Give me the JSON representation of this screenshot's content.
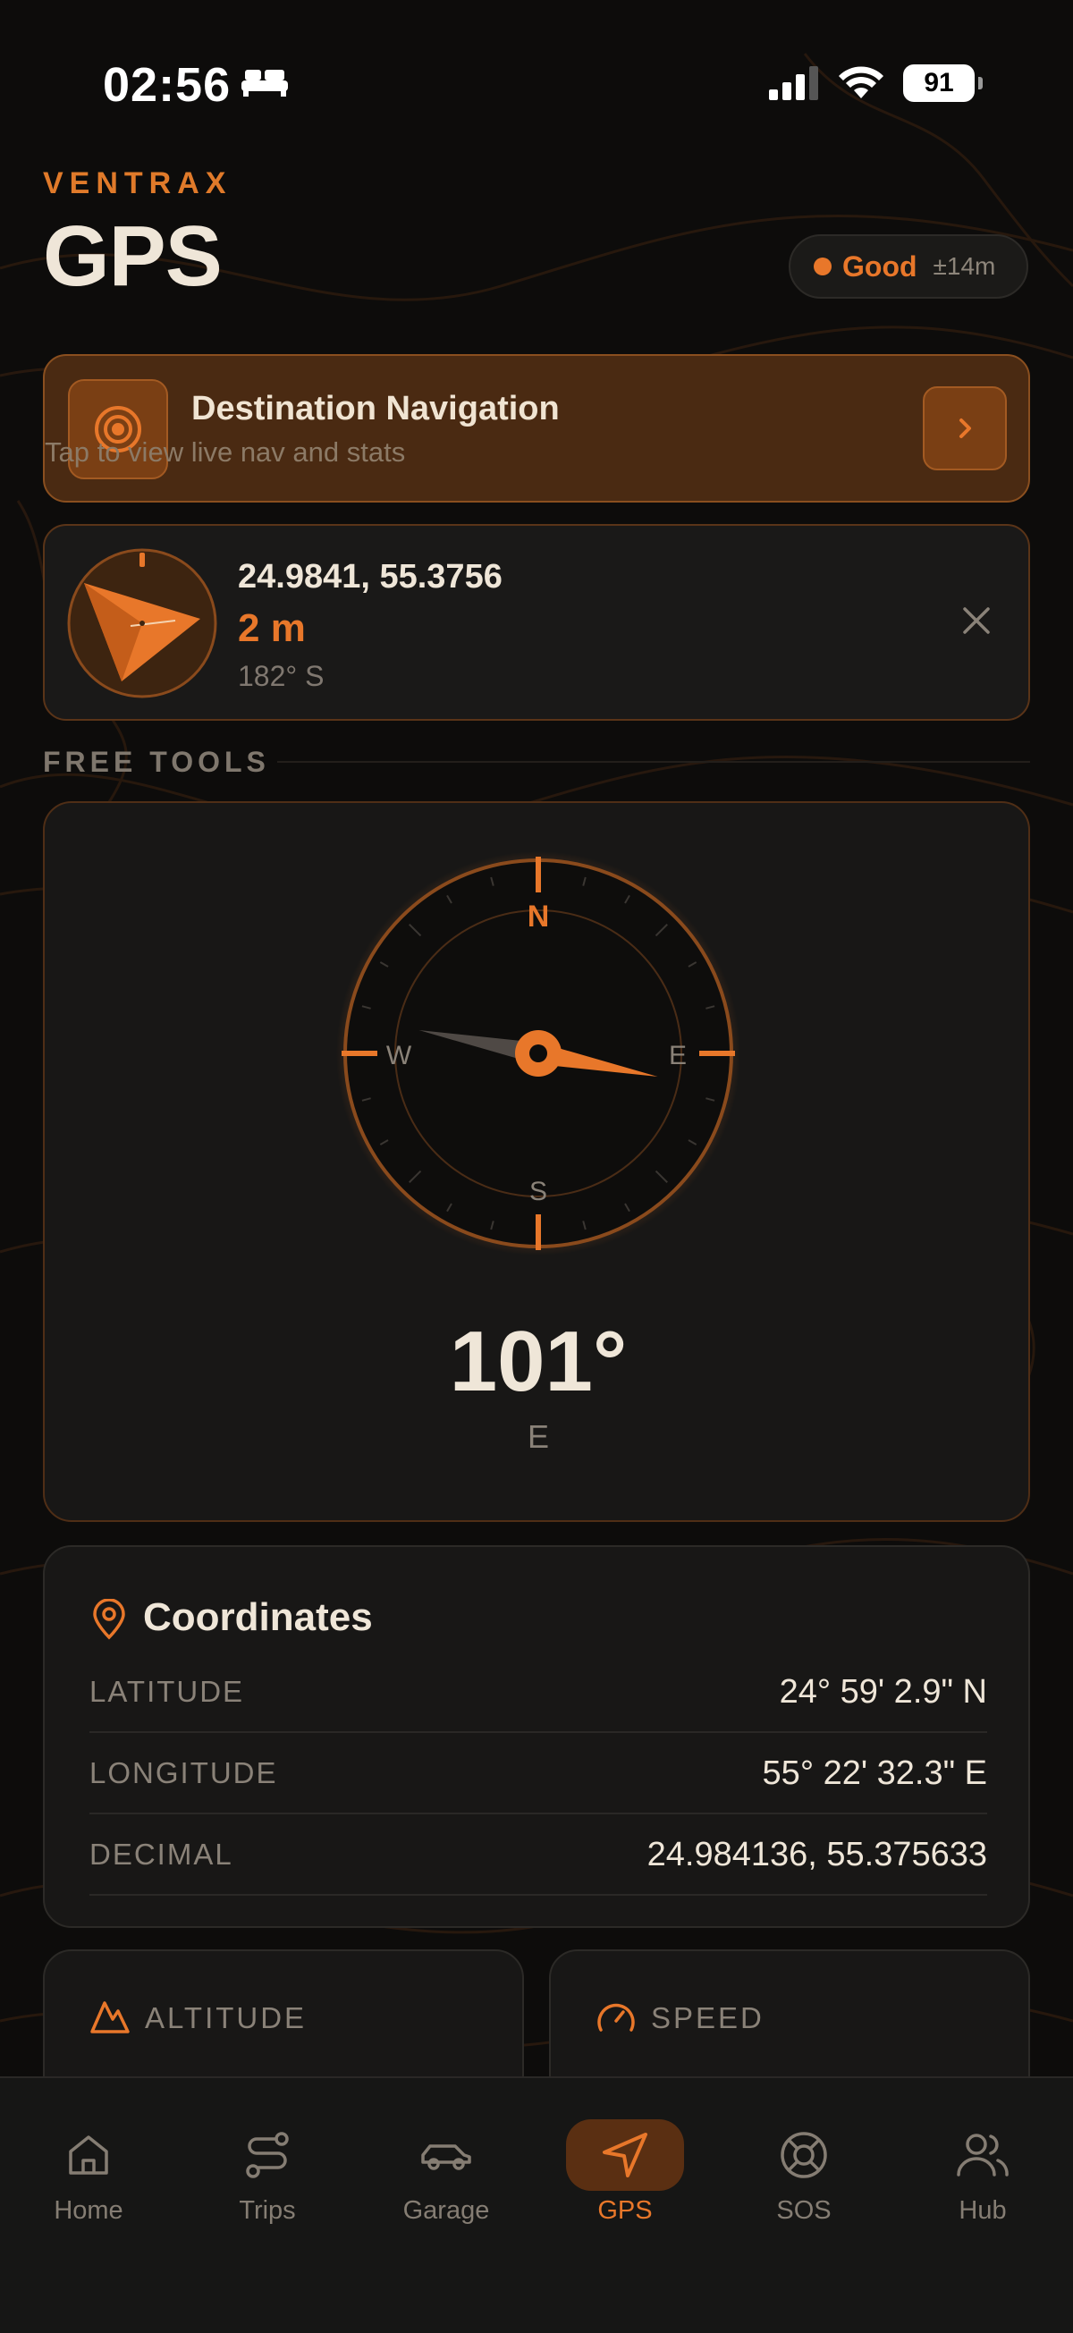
{
  "status_bar": {
    "time": "02:56",
    "battery": "91"
  },
  "header": {
    "brand": "VENTRAX",
    "title": "GPS"
  },
  "gps_signal": {
    "quality": "Good",
    "accuracy": "±14m"
  },
  "destination": {
    "title": "Destination Navigation",
    "subtitle": "Tap to view live nav and stats"
  },
  "waypoint": {
    "coords": "24.9841, 55.3756",
    "distance": "2 m",
    "bearing": "182°  S"
  },
  "section": {
    "free_tools": "FREE TOOLS"
  },
  "compass": {
    "cardinal": {
      "n": "N",
      "e": "E",
      "s": "S",
      "w": "W"
    },
    "heading": "101°",
    "heading_dir": "E",
    "heading_degrees": 101
  },
  "coordinates": {
    "title": "Coordinates",
    "rows": [
      {
        "key": "LATITUDE",
        "value": "24° 59' 2.9\" N"
      },
      {
        "key": "LONGITUDE",
        "value": "55° 22' 32.3\" E"
      },
      {
        "key": "DECIMAL",
        "value": "24.984136, 55.375633"
      }
    ]
  },
  "stats": {
    "altitude": "ALTITUDE",
    "speed": "SPEED"
  },
  "tabs": [
    {
      "label": "Home",
      "icon": "home-icon"
    },
    {
      "label": "Trips",
      "icon": "route-icon"
    },
    {
      "label": "Garage",
      "icon": "car-icon"
    },
    {
      "label": "GPS",
      "icon": "navigation-icon",
      "active": true
    },
    {
      "label": "SOS",
      "icon": "lifebuoy-icon"
    },
    {
      "label": "Hub",
      "icon": "users-icon"
    }
  ],
  "colors": {
    "accent": "#e8772a",
    "background": "#0d0c0b",
    "card": "#181716"
  }
}
